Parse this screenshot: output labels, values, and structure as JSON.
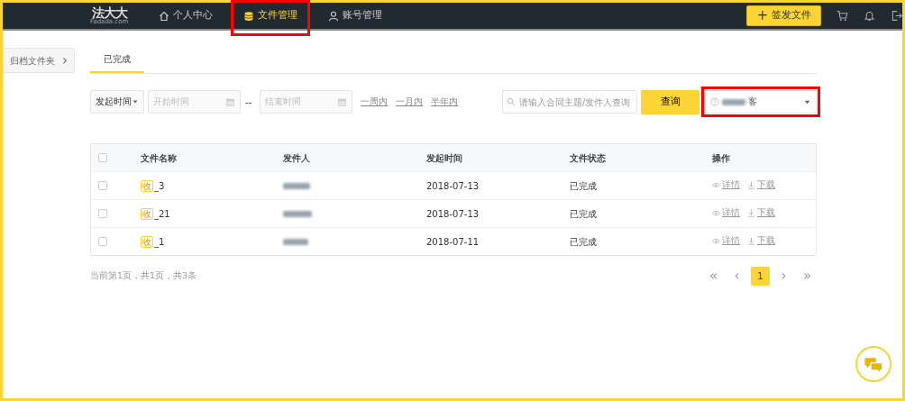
{
  "navbar": {
    "logo": {
      "name": "法大大",
      "subtitle": "Fadada.com"
    },
    "items": [
      {
        "label": "个人中心",
        "selected": false,
        "highlighted": false
      },
      {
        "label": "文件管理",
        "selected": true,
        "highlighted": true
      },
      {
        "label": "账号管理",
        "selected": false,
        "highlighted": false
      }
    ],
    "sign_button": {
      "icon": "+",
      "label": "签发文件"
    }
  },
  "side_tab": {
    "label": "归档文件夹",
    "arrow": "›"
  },
  "tabs": [
    {
      "label": "已完成",
      "selected": true
    }
  ],
  "filters": {
    "time_type": "发起时间",
    "start": {
      "placeholder": "开始时间"
    },
    "separator": "--",
    "end": {
      "placeholder": "结束时间"
    },
    "quick_ranges": [
      "一周内",
      "一月内",
      "半年内"
    ],
    "search": {
      "placeholder": "请输入合同主题/发件人查询"
    },
    "query_button": "查询",
    "account_select": {
      "value_suffix": "客",
      "highlighted": true
    }
  },
  "table": {
    "select_all_checked": false,
    "columns": [
      "文件名称",
      "发件人",
      "发起时间",
      "文件状态",
      "操作"
    ],
    "rows": [
      {
        "checked": false,
        "tag": "收",
        "name": "_3",
        "date": "2018-07-13",
        "status": "已完成",
        "actions": [
          "详情",
          "下载"
        ]
      },
      {
        "checked": false,
        "tag": "收",
        "name": "_21",
        "date": "2018-07-13",
        "status": "已完成",
        "actions": [
          "详情",
          "下载"
        ]
      },
      {
        "checked": false,
        "tag": "收",
        "name": "_1",
        "date": "2018-07-11",
        "status": "已完成",
        "actions": [
          "详情",
          "下载"
        ]
      }
    ]
  },
  "pagination": {
    "summary": "当前第1页，共1页，共3条",
    "first": "«",
    "prev": "‹",
    "pages": [
      {
        "label": "1",
        "selected": true
      }
    ],
    "next": "›",
    "last": "»"
  }
}
